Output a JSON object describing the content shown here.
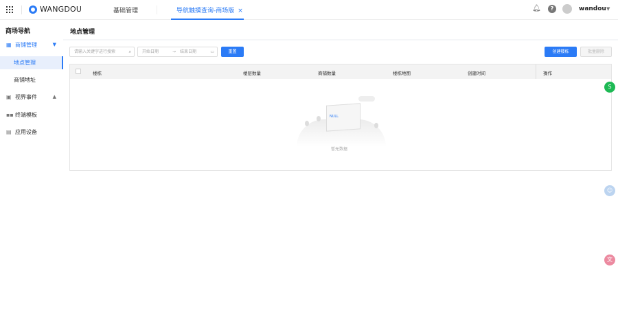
{
  "header": {
    "brand": "WANGDOU",
    "tabs": [
      {
        "label": "基础管理"
      },
      {
        "label": "导航触摸查询-商场版",
        "active": true
      }
    ],
    "close_icon": "×",
    "user": "wandou"
  },
  "sidebar": {
    "title": "商场导航",
    "items": [
      {
        "label": "商铺管理",
        "expanded": true
      },
      {
        "label": "地点管理",
        "active": true
      },
      {
        "label": "商铺地址"
      },
      {
        "label": "视界事件"
      },
      {
        "label": "终端模板"
      },
      {
        "label": "应用设备"
      }
    ]
  },
  "page": {
    "title": "地点管理"
  },
  "filters": {
    "search_placeholder": "请输入关键字进行搜索",
    "start_placeholder": "开始日期",
    "end_placeholder": "结束日期",
    "arrow": "→",
    "reset": "重置"
  },
  "actions": {
    "create": "创建楼栋",
    "batch_delete": "批量删除"
  },
  "table": {
    "columns": [
      "楼栋",
      "楼层数量",
      "商铺数量",
      "楼栋地图",
      "创建时间",
      "操作"
    ],
    "empty_text": "暂无数据",
    "empty_image_text": "NULL"
  },
  "colors": {
    "accent": "#2b7bf6"
  }
}
